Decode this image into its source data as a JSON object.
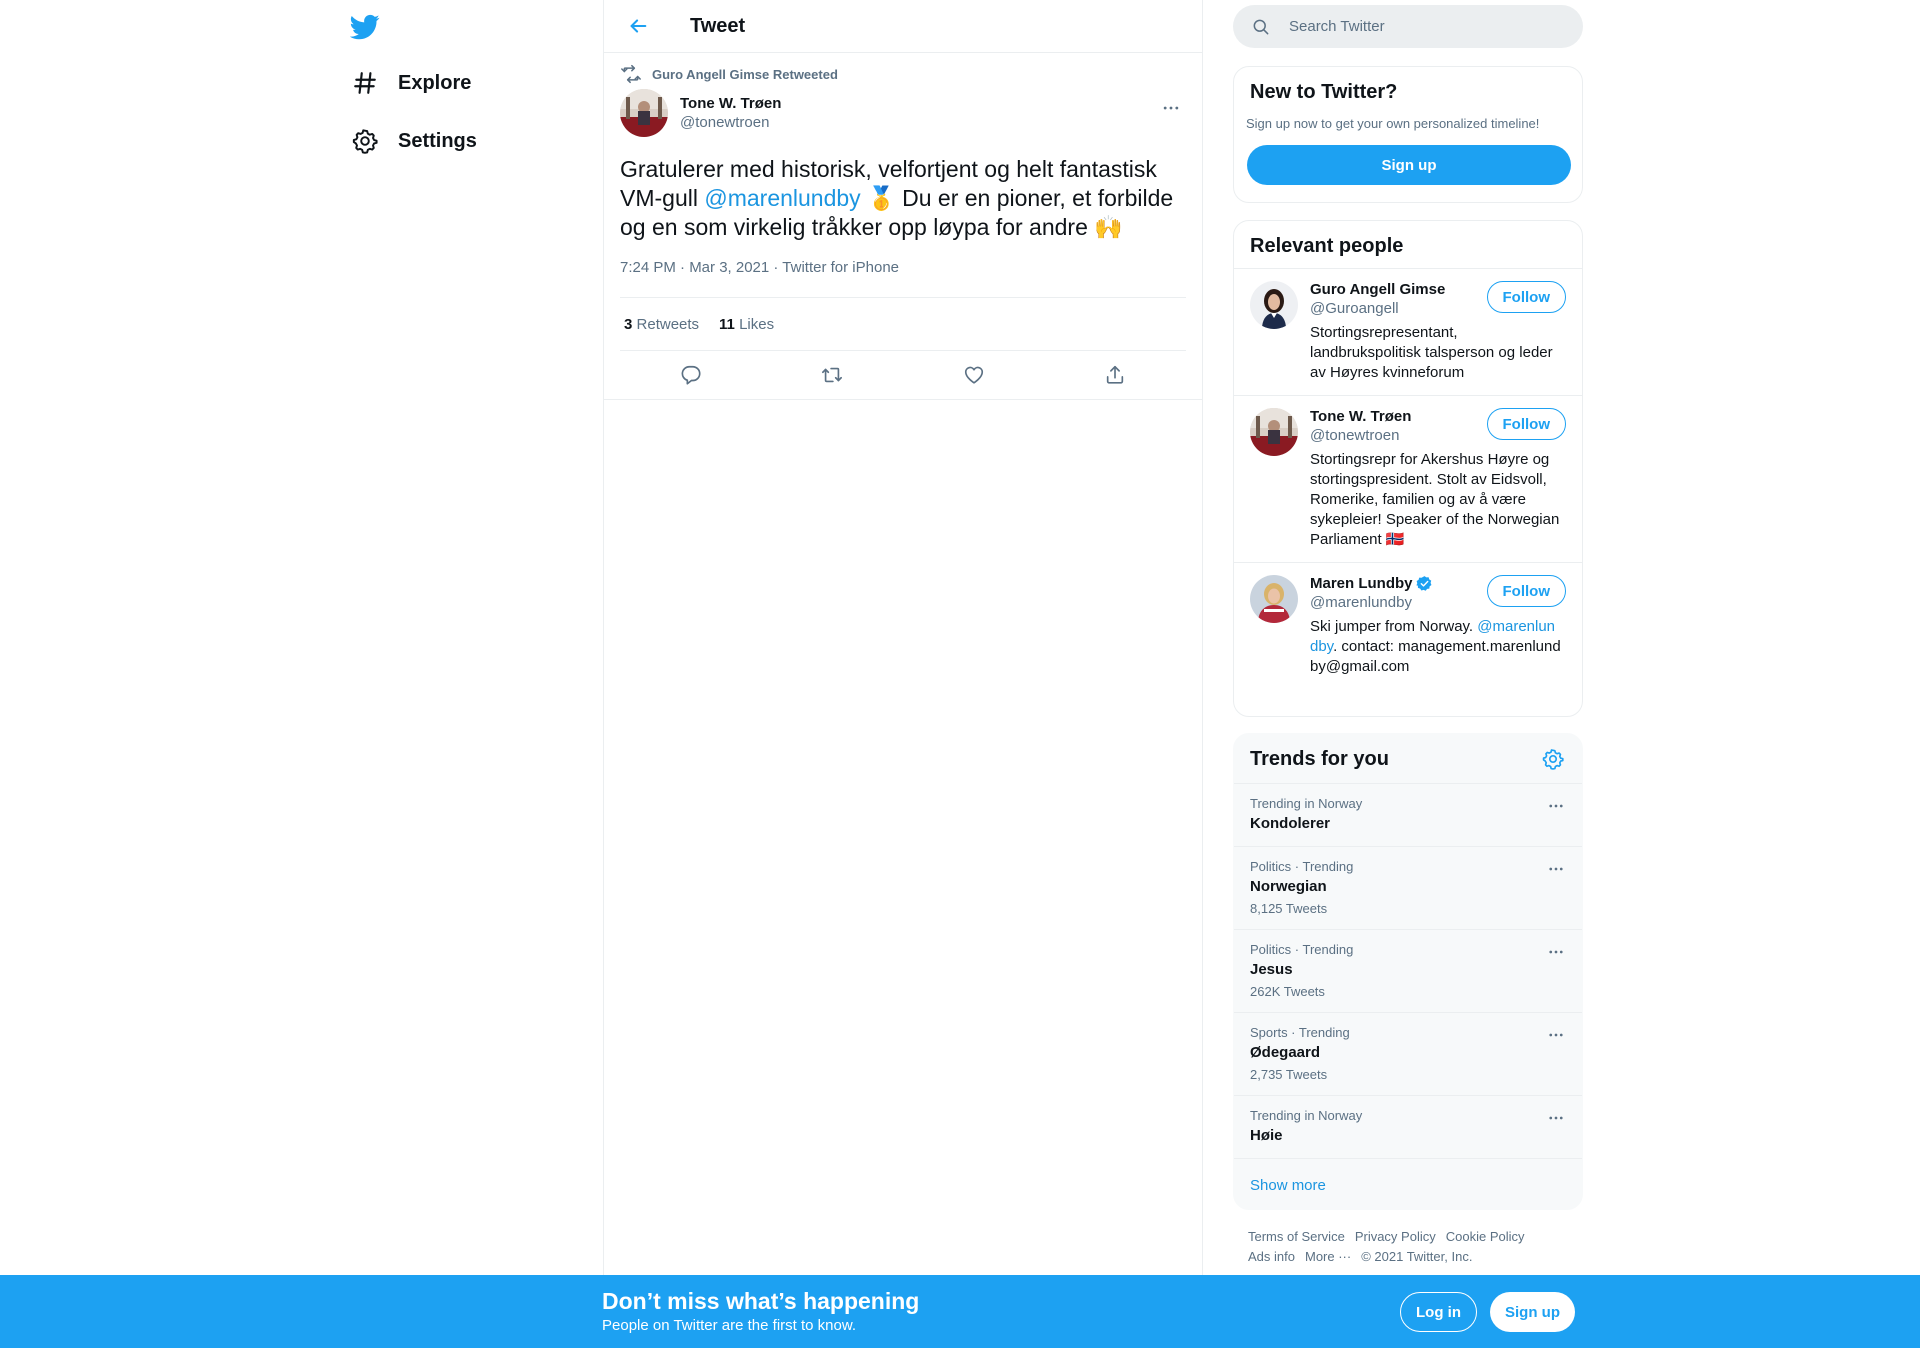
{
  "colors": {
    "accent": "#1da1f2",
    "link": "#1b95e0",
    "muted": "#5b7083",
    "text": "#0f1419",
    "border": "#ebeef0"
  },
  "nav": {
    "items": [
      {
        "label": "Explore",
        "icon": "hashtag-icon"
      },
      {
        "label": "Settings",
        "icon": "gear-icon"
      }
    ]
  },
  "main": {
    "title": "Tweet",
    "retweet_label": "Guro Angell Gimse Retweeted",
    "author": {
      "name": "Tone W. Trøen",
      "handle": "@tonewtroen"
    },
    "text_before": "Gratulerer med historisk, velfortjent og helt fantastisk VM-gull ",
    "mention": "@marenlundby",
    "text_after": " 🥇 Du er en pioner, et forbilde og en som virkelig tråkker opp løypa for andre 🙌",
    "meta": "7:24 PM · Mar 3, 2021 · Twitter for iPhone",
    "stats": {
      "retweets_count": "3",
      "retweets_label": "Retweets",
      "likes_count": "11",
      "likes_label": "Likes"
    }
  },
  "search": {
    "placeholder": "Search Twitter"
  },
  "new_to_twitter": {
    "title": "New to Twitter?",
    "subtitle": "Sign up now to get your own personalized timeline!",
    "signup_label": "Sign up"
  },
  "relevant_people": {
    "title": "Relevant people",
    "follow_label": "Follow",
    "people": [
      {
        "name": "Guro Angell Gimse",
        "handle": "@Guroangell",
        "bio": "Stortingsrepresentant, landbrukspolitisk talsperson og leder av Høyres kvinneforum"
      },
      {
        "name": "Tone W. Trøen",
        "handle": "@tonewtroen",
        "bio": "Stortingsrepr for Akershus Høyre og stortingspresident. Stolt av Eidsvoll, Romerike, familien og av å være sykepleier! Speaker of the Norwegian Parliament 🇳🇴"
      },
      {
        "name": "Maren Lundby",
        "handle": "@marenlundby",
        "bio_before": "Ski jumper from Norway. ",
        "bio_mention": "@marenlundby",
        "bio_after": ". contact: management.marenlundby@gmail.com"
      }
    ]
  },
  "trends": {
    "title": "Trends for you",
    "items": [
      {
        "context": "Trending in Norway",
        "name": "Kondolerer",
        "count": ""
      },
      {
        "context": "Politics · Trending",
        "name": "Norwegian",
        "count": "8,125 Tweets"
      },
      {
        "context": "Politics · Trending",
        "name": "Jesus",
        "count": "262K Tweets"
      },
      {
        "context": "Sports · Trending",
        "name": "Ødegaard",
        "count": "2,735 Tweets"
      },
      {
        "context": "Trending in Norway",
        "name": "Høie",
        "count": ""
      }
    ],
    "show_more": "Show more"
  },
  "footer": {
    "links": [
      "Terms of Service",
      "Privacy Policy",
      "Cookie Policy",
      "Ads info",
      "More ···"
    ],
    "copyright": "© 2021 Twitter, Inc."
  },
  "bottom_bar": {
    "title": "Don’t miss what’s happening",
    "subtitle": "People on Twitter are the first to know.",
    "login_label": "Log in",
    "signup_label": "Sign up"
  }
}
